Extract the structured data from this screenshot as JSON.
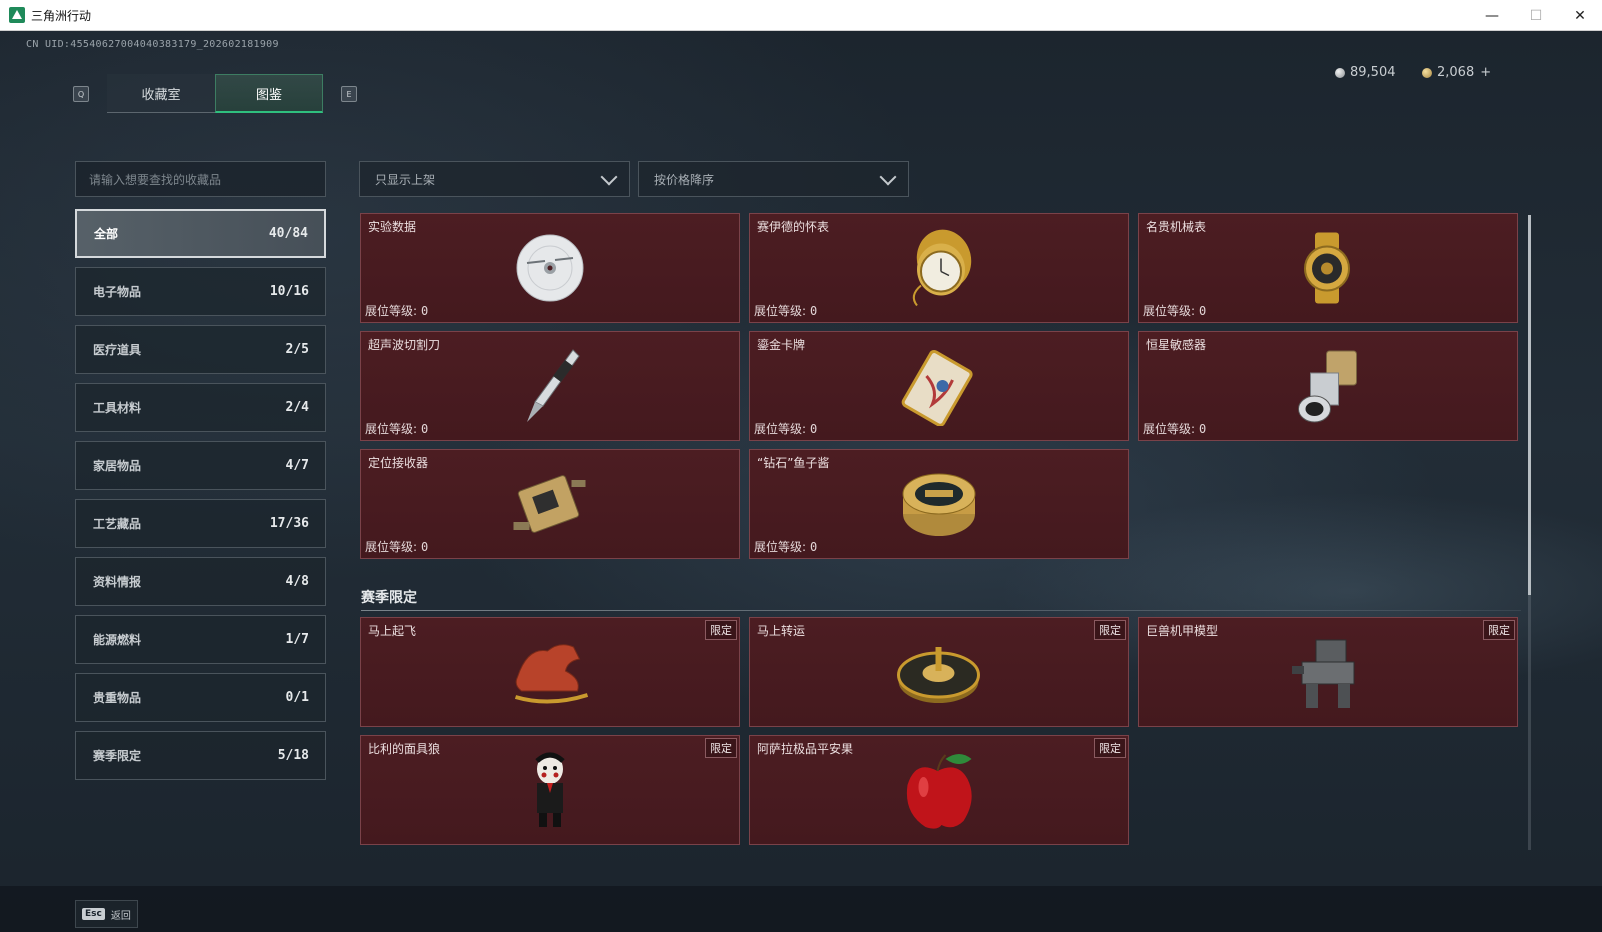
{
  "window": {
    "title": "三角洲行动",
    "minimize": "—",
    "maximize": "☐",
    "close": "✕"
  },
  "uid": "CN UID:4554062700404038​3179_202602181909",
  "tabs": {
    "q_key": "Q",
    "e_key": "E",
    "items": [
      {
        "label": "收藏室"
      },
      {
        "label": "图鉴"
      }
    ]
  },
  "currency": {
    "silver": "89,504",
    "gold": "2,068",
    "add": "+"
  },
  "search": {
    "placeholder": "请输入想要查找的收藏品"
  },
  "filters": {
    "shelf": "只显示上架",
    "sort": "按价格降序"
  },
  "categories": [
    {
      "label": "全部",
      "count": "40/84"
    },
    {
      "label": "电子物品",
      "count": "10/16"
    },
    {
      "label": "医疗道具",
      "count": "2/5"
    },
    {
      "label": "工具材料",
      "count": "2/4"
    },
    {
      "label": "家居物品",
      "count": "4/7"
    },
    {
      "label": "工艺藏品",
      "count": "17/36"
    },
    {
      "label": "资料情报",
      "count": "4/8"
    },
    {
      "label": "能源燃料",
      "count": "1/7"
    },
    {
      "label": "贵重物品",
      "count": "0/1"
    },
    {
      "label": "赛季限定",
      "count": "5/18"
    }
  ],
  "level_label": "展位等级:",
  "items": [
    {
      "name": "实验数据",
      "level": "0",
      "icon": "disc-icon"
    },
    {
      "name": "赛伊德的怀表",
      "level": "0",
      "icon": "pocket-watch-icon"
    },
    {
      "name": "名贵机械表",
      "level": "0",
      "icon": "gold-watch-icon"
    },
    {
      "name": "超声波切割刀",
      "level": "0",
      "icon": "ultrasonic-cutter-icon"
    },
    {
      "name": "鎏金卡牌",
      "level": "0",
      "icon": "gilded-card-icon"
    },
    {
      "name": "恒星敏感器",
      "level": "0",
      "icon": "star-sensor-icon"
    },
    {
      "name": "定位接收器",
      "level": "0",
      "icon": "gps-receiver-icon"
    },
    {
      "name": "“钻石”鱼子酱",
      "level": "0",
      "icon": "caviar-tin-icon"
    }
  ],
  "season": {
    "title": "赛季限定",
    "badge": "限定",
    "items": [
      {
        "name": "马上起飞",
        "icon": "red-horse-icon"
      },
      {
        "name": "马上转运",
        "icon": "roulette-icon"
      },
      {
        "name": "巨兽机甲模型",
        "icon": "mech-model-icon"
      },
      {
        "name": "比利的面具狼",
        "icon": "billy-puppet-icon"
      },
      {
        "name": "阿萨拉极品平安果",
        "icon": "apple-icon"
      }
    ]
  },
  "bottom": {
    "esc_key": "Esc",
    "back": "返回"
  }
}
